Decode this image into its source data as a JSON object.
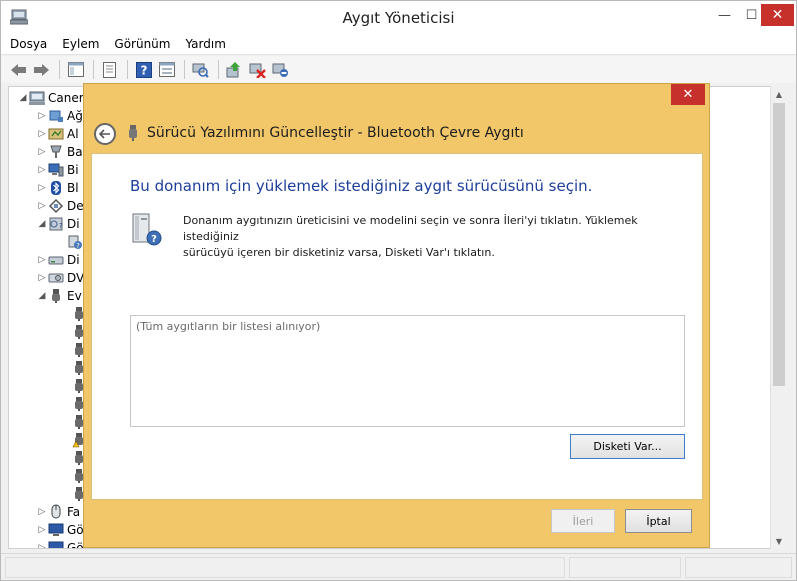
{
  "window": {
    "title": "Aygıt Yöneticisi",
    "minimize_glyph": "—",
    "maximize_glyph": "☐",
    "close_glyph": "✕"
  },
  "menu": {
    "items": [
      "Dosya",
      "Eylem",
      "Görünüm",
      "Yardım"
    ]
  },
  "tree": {
    "rows": [
      {
        "label": "Caner",
        "arrow": "◢",
        "icon": "computer-icon"
      },
      {
        "label": "Ağ",
        "arrow": "▷",
        "icon": "network-adapter-icon"
      },
      {
        "label": "Al",
        "arrow": "▷",
        "icon": "audio-icon"
      },
      {
        "label": "Ba",
        "arrow": "▷",
        "icon": "bus-icon"
      },
      {
        "label": "Bi",
        "arrow": "▷",
        "icon": "monitor-icon"
      },
      {
        "label": "Bl",
        "arrow": "▷",
        "icon": "bluetooth-icon"
      },
      {
        "label": "De",
        "arrow": "▷",
        "icon": "controller-icon"
      },
      {
        "label": "Di",
        "arrow": "◢",
        "icon": "disk-icon"
      },
      {
        "label": "",
        "arrow": "",
        "icon": "unknown-device-icon"
      },
      {
        "label": "Di",
        "arrow": "▷",
        "icon": "drive-icon"
      },
      {
        "label": "DV",
        "arrow": "▷",
        "icon": "dvd-icon"
      },
      {
        "label": "Ev",
        "arrow": "◢",
        "icon": "usb-icon"
      },
      {
        "label": "Fa",
        "arrow": "▷",
        "icon": "mouse-icon"
      },
      {
        "label": "Gö",
        "arrow": "▷",
        "icon": "display-icon"
      },
      {
        "label": "Gö",
        "arrow": "▷",
        "icon": "display-icon"
      }
    ],
    "subdevice_count_display": ""
  },
  "dialog": {
    "title": "Sürücü Yazılımını Güncelleştir - Bluetooth Çevre Aygıtı",
    "close_glyph": "✕",
    "heading": "Bu donanım için yüklemek istediğiniz aygıt sürücüsünü seçin.",
    "info_line1": "Donanım aygıtınızın üreticisini ve modelini seçin ve sonra İleri'yi tıklatın. Yüklemek istediğiniz",
    "info_line2": "sürücüyü içeren bir disketiniz varsa, Disketi Var'ı tıklatın.",
    "list_placeholder": "(Tüm aygıtların bir listesi alınıyor)",
    "have_disk_label": "Disketi Var...",
    "next_label": "İleri",
    "cancel_label": "İptal"
  }
}
